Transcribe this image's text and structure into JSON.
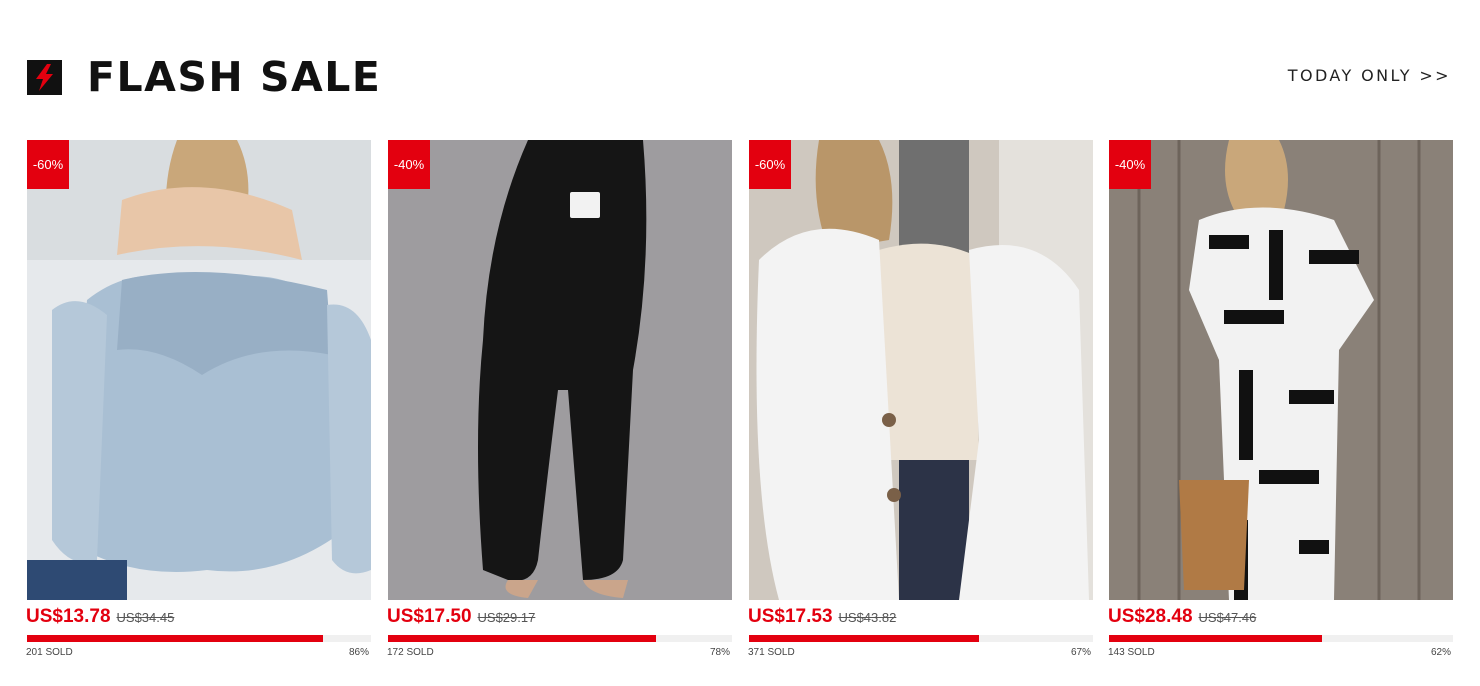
{
  "header": {
    "title": "FLASH SALE",
    "link": "TODAY ONLY >>",
    "icon": "lightning-bolt-icon",
    "accent": "#e3000f"
  },
  "products": [
    {
      "discount": "-60%",
      "price": "US$13.78",
      "old_price": "US$34.45",
      "sold": "201 SOLD",
      "percent": "86%",
      "progress": 0.86,
      "image": "light blue off-shoulder smocked blouse"
    },
    {
      "discount": "-40%",
      "price": "US$17.50",
      "old_price": "US$29.17",
      "sold": "172 SOLD",
      "percent": "78%",
      "progress": 0.78,
      "image": "black high-waist bootcut yoga pants"
    },
    {
      "discount": "-60%",
      "price": "US$17.53",
      "old_price": "US$43.82",
      "sold": "371 SOLD",
      "percent": "67%",
      "progress": 0.67,
      "image": "white fuzzy teddy cardigan"
    },
    {
      "discount": "-40%",
      "price": "US$28.48",
      "old_price": "US$47.46",
      "sold": "143 SOLD",
      "percent": "62%",
      "progress": 0.62,
      "image": "black and white geometric print two-piece set"
    }
  ]
}
